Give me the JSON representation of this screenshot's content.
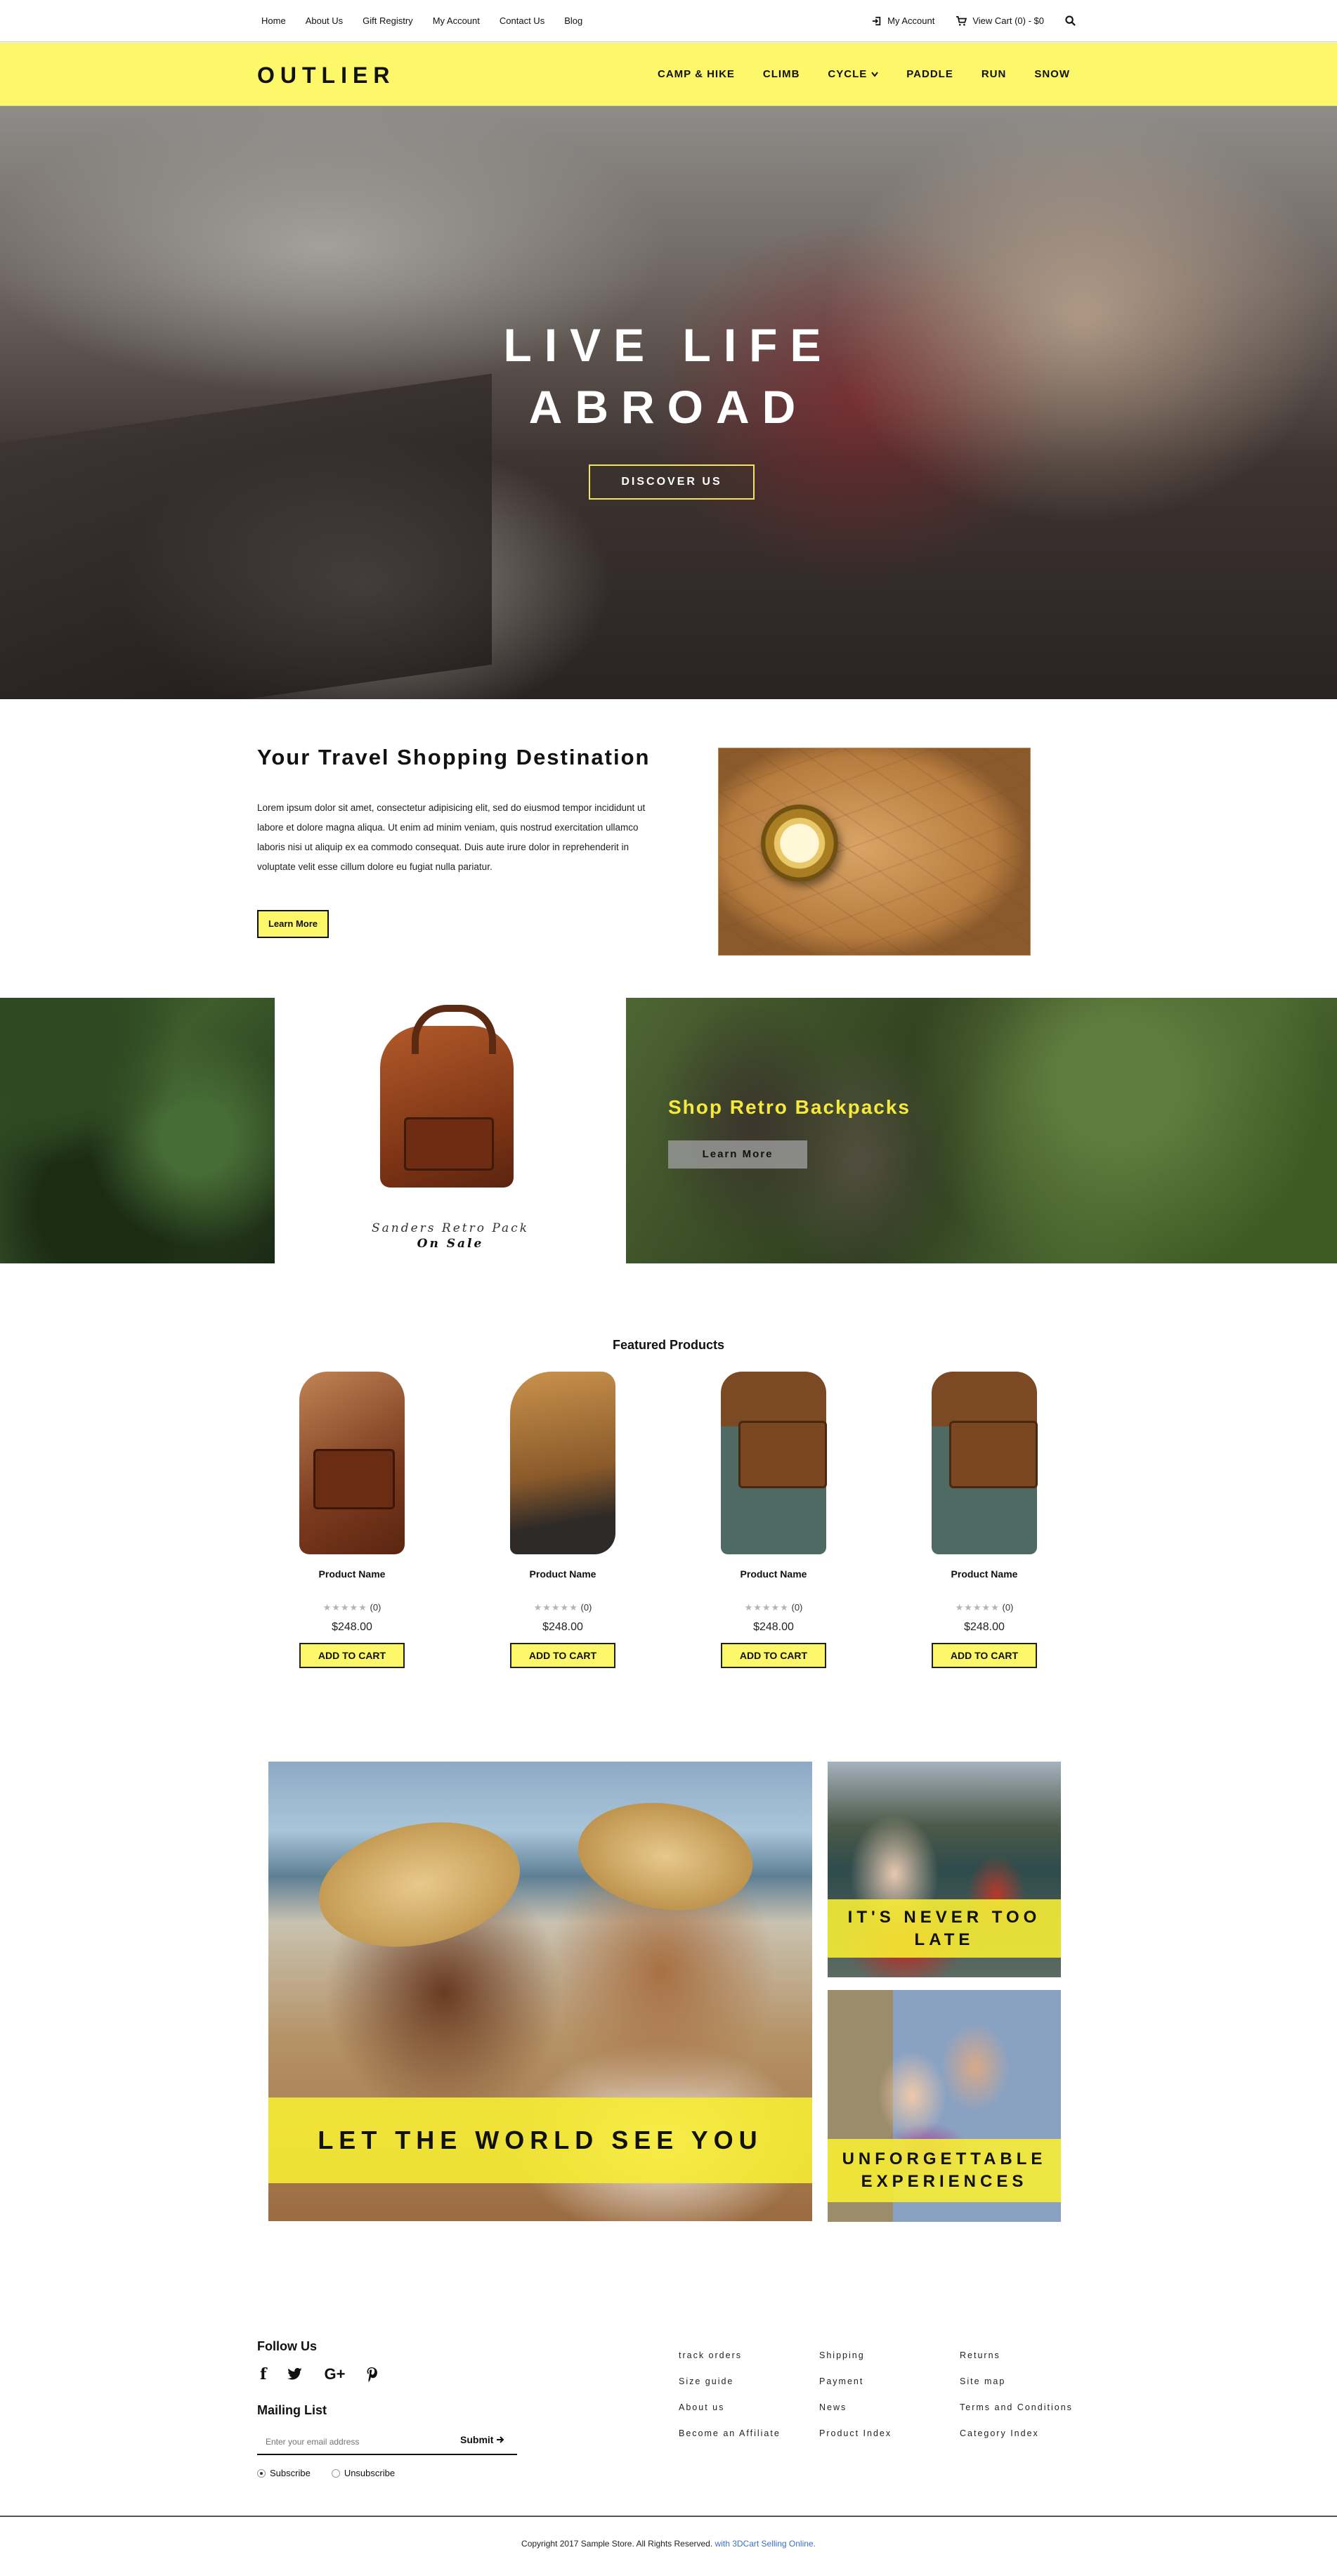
{
  "topbar": {
    "links": [
      "Home",
      "About Us",
      "Gift Registry",
      "My Account",
      "Contact Us",
      "Blog"
    ],
    "account": "My Account",
    "cart": "View Cart (0) - $0"
  },
  "header": {
    "logo": "OUTLIER",
    "nav": [
      "CAMP & HIKE",
      "CLIMB",
      "CYCLE",
      "PADDLE",
      "RUN",
      "SNOW"
    ]
  },
  "hero": {
    "line1": "LIVE LIFE",
    "line2": "ABROAD",
    "button": "DISCOVER US"
  },
  "about": {
    "title": "Your Travel Shopping Destination",
    "body": "Lorem ipsum dolor sit amet, consectetur adipisicing elit, sed do eiusmod tempor incididunt ut labore et dolore magna aliqua. Ut enim ad minim veniam, quis nostrud exercitation ullamco laboris nisi ut aliquip ex ea commodo consequat. Duis aute irure dolor in reprehenderit in voluptate velit esse cillum dolore eu fugiat nulla pariatur.",
    "button": "Learn More"
  },
  "promo": {
    "caption1": "Sanders Retro Pack",
    "caption2": "On Sale",
    "banner_title": "Shop Retro Backpacks",
    "banner_button": "Learn More"
  },
  "featured": {
    "title": "Featured Products",
    "products": [
      {
        "name": "Product Name",
        "rating": 0,
        "reviews": "(0)",
        "price": "$248.00",
        "button": "ADD TO CART",
        "icon": "brown-backpack"
      },
      {
        "name": "Product Name",
        "rating": 0,
        "reviews": "(0)",
        "price": "$248.00",
        "button": "ADD TO CART",
        "icon": "hiking-boot"
      },
      {
        "name": "Product Name",
        "rating": 0,
        "reviews": "(0)",
        "price": "$248.00",
        "button": "ADD TO CART",
        "icon": "green-backpack"
      },
      {
        "name": "Product Name",
        "rating": 0,
        "reviews": "(0)",
        "price": "$248.00",
        "button": "ADD TO CART",
        "icon": "green-backpack"
      }
    ]
  },
  "collage": {
    "big": "LET THE WORLD SEE YOU",
    "small1": "IT'S NEVER TOO LATE",
    "small2": "UNFORGETTABLE EXPERIENCES"
  },
  "footer": {
    "follow": "Follow Us",
    "mailing": "Mailing List",
    "email_placeholder": "Enter your email address",
    "submit": "Submit",
    "subscribe": "Subscribe",
    "unsubscribe": "Unsubscribe",
    "col1": [
      "track orders",
      "Size guide",
      "About us",
      "Become an Affiliate"
    ],
    "col2": [
      "Shipping",
      "Payment",
      "News",
      "Product Index"
    ],
    "col3": [
      "Returns",
      "Site map",
      "Terms and Conditions",
      "Category Index"
    ],
    "copyright": "Copyright 2017 Sample Store. All Rights Reserved.",
    "copyright_link": "with 3DCart Selling Online."
  },
  "colors": {
    "accent_yellow": "#fdf76a",
    "banner_text_yellow": "#f5ea3c",
    "link_blue": "#3a6fc9"
  }
}
